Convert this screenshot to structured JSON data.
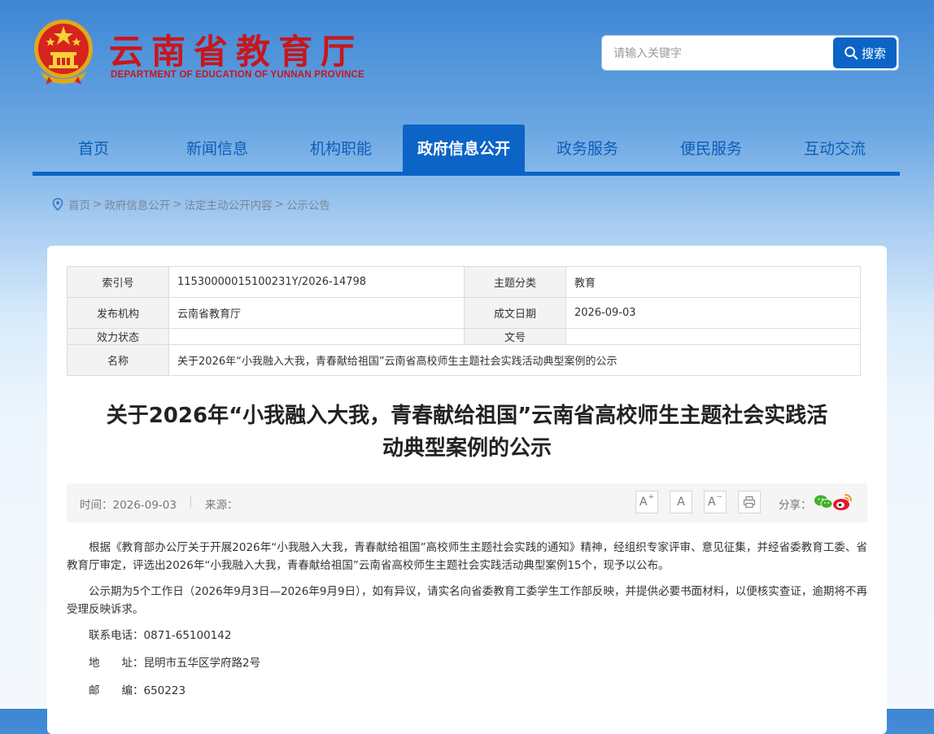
{
  "header": {
    "title": "云南省教育厅",
    "subtitle": "DEPARTMENT OF EDUCATION OF YUNNAN PROVINCE",
    "search_placeholder": "请输入关键字",
    "search_button": "搜索"
  },
  "nav": {
    "items": [
      "首页",
      "新闻信息",
      "机构职能",
      "政府信息公开",
      "政务服务",
      "便民服务",
      "互动交流"
    ],
    "active": "政府信息公开"
  },
  "breadcrumb": [
    "首页",
    "政府信息公开",
    "法定主动公开内容",
    "公示公告"
  ],
  "meta": {
    "index_label": "索引号",
    "index_value": "11530000015100231Y/2026-14798",
    "category_label": "主题分类",
    "category_value": "教育",
    "publisher_label": "发布机构",
    "publisher_value": "云南省教育厅",
    "date_label": "成文日期",
    "date_value": "2026-09-03",
    "status_label": "效力状态",
    "status_value": "",
    "docno_label": "文号",
    "docno_value": "",
    "name_label": "名称",
    "name_value": "关于2026年“小我融入大我，青春献给祖国”云南省高校师生主题社会实践活动典型案例的公示"
  },
  "article": {
    "title_line1": "关于2026年“小我融入大我，青春献给祖国”云南省高校师生主题社会实践活",
    "title_line2": "动典型案例的公示",
    "time": "时间：2026-09-03",
    "source": "来源：",
    "font_increase": "A",
    "font_normal": "A",
    "font_decrease": "A",
    "share_label": "分享：",
    "paragraphs": [
      "根据《教育部办公厅关于开展2026年“小我融入大我，青春献给祖国”高校师生主题社会实践的通知》精神，经组织专家评审、意见征集，并经省委教育工委、省教育厅审定，评选出2026年“小我融入大我，青春献给祖国”云南省高校师生主题社会实践活动典型案例15个，现予以公布。",
      "公示期为5个工作日（2026年9月3日—2026年9月9日），如有异议，请实名向省委教育工委学生工作部反映，并提供必要书面材料，以便核实查证，逾期将不再受理反映诉求。"
    ],
    "contact_phone": "联系电话：0871-65100142",
    "address": "地　　址：昆明市五华区学府路2号",
    "postcode": "邮　　编：650223"
  },
  "colors": {
    "brand_red": "#c8161d",
    "brand_blue": "#0b64c6"
  }
}
